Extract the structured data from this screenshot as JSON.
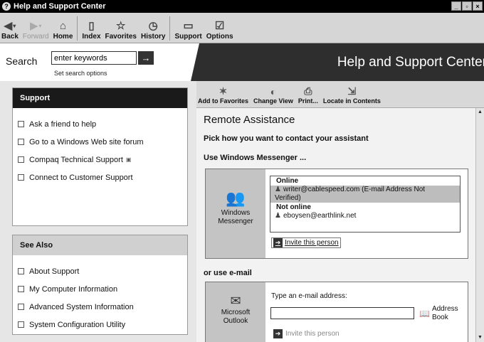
{
  "window": {
    "title": "Help and Support Center",
    "controls": [
      "_",
      "▫",
      "×"
    ]
  },
  "toolbar": {
    "back": "Back",
    "forward": "Forward",
    "home": "Home",
    "index": "Index",
    "favorites": "Favorites",
    "history": "History",
    "support": "Support",
    "options": "Options"
  },
  "search": {
    "label": "Search",
    "value": "enter keywords",
    "go": "→",
    "set_options": "Set search options"
  },
  "banner": {
    "title": "Help and Support Center"
  },
  "sidebar": {
    "support": {
      "title": "Support",
      "items": [
        {
          "label": "Ask a friend to help"
        },
        {
          "label": "Go to a Windows Web site forum"
        },
        {
          "label": "Compaq Technical Support",
          "external": true
        },
        {
          "label": "Connect to Customer Support"
        }
      ]
    },
    "see_also": {
      "title": "See Also",
      "items": [
        {
          "label": "About Support"
        },
        {
          "label": "My Computer Information"
        },
        {
          "label": "Advanced System Information"
        },
        {
          "label": "System Configuration Utility"
        }
      ]
    }
  },
  "subtoolbar": {
    "add_favorites": "Add to Favorites",
    "change_view": "Change View",
    "print": "Print...",
    "locate": "Locate in Contents"
  },
  "content": {
    "title": "Remote Assistance",
    "subtitle": "Pick how you want to contact your assistant",
    "messenger_heading": "Use Windows Messenger ...",
    "messenger_caption_1": "Windows",
    "messenger_caption_2": "Messenger",
    "online_label": "Online",
    "online_contact_1": "writer@cablespeed.com (E-mail Address Not",
    "online_contact_2": "Verified)",
    "offline_label": "Not online",
    "offline_contact": "eboysen@earthlink.net",
    "invite_label": "Invite this person",
    "email_heading": "or use e-mail",
    "outlook_caption_1": "Microsoft",
    "outlook_caption_2": "Outlook",
    "type_email_label": "Type an e-mail address:",
    "email_value": "",
    "address_book_1": "Address",
    "address_book_2": "Book",
    "email_invite_label": "Invite this person"
  },
  "colors": {
    "titlebar": "#000000",
    "banner": "#2e2e2e",
    "sidebar_bg": "#e6e6e6",
    "selected_row": "#bdbdbd"
  }
}
